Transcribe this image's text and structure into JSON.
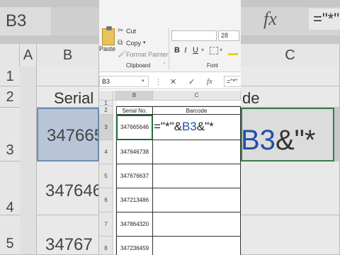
{
  "background": {
    "name_box": "B3",
    "fx_symbol": "fx",
    "formula_preview": "=\"*\"",
    "col_a": "A",
    "col_b": "B",
    "col_c": "C",
    "rows": [
      "1",
      "2",
      "3",
      "4",
      "5"
    ],
    "header_serial": "Serial N",
    "header_code": "de",
    "cells": [
      "347665",
      "347646",
      "34767"
    ],
    "formula_prefix": "B3",
    "formula_suffix": "&\"*"
  },
  "ribbon": {
    "paste": "Paste",
    "cut": "Cut",
    "copy": "Copy",
    "copy_caret": "▾",
    "format_painter": "Format Painter",
    "clipboard_group": "Clipboard",
    "clipboard_launcher": "⌝",
    "font_size": "28",
    "bold": "B",
    "italic": "I",
    "underline": "U",
    "font_group": "Font"
  },
  "formula_bar": {
    "name_box": "B3",
    "name_caret": "▾",
    "more": "⋮",
    "cancel": "✕",
    "enter": "✓",
    "fx": "fx",
    "value": "=\"*\""
  },
  "grid": {
    "columns": [
      "A",
      "B",
      "C"
    ],
    "row_labels": [
      "1",
      "2",
      "3",
      "4",
      "5",
      "6",
      "7",
      "8"
    ],
    "header_serial": "Serial No.",
    "header_barcode": "Barcode",
    "serials": [
      "347665646",
      "347646738",
      "347676637",
      "347213486",
      "347864320",
      "347236459"
    ],
    "formula_before": "=\"*\"&",
    "formula_ref": "B3",
    "formula_after": "&\"*"
  },
  "colors": {
    "selection_border": "#1d6e3a",
    "reference_blue": "#1f4fa8"
  }
}
